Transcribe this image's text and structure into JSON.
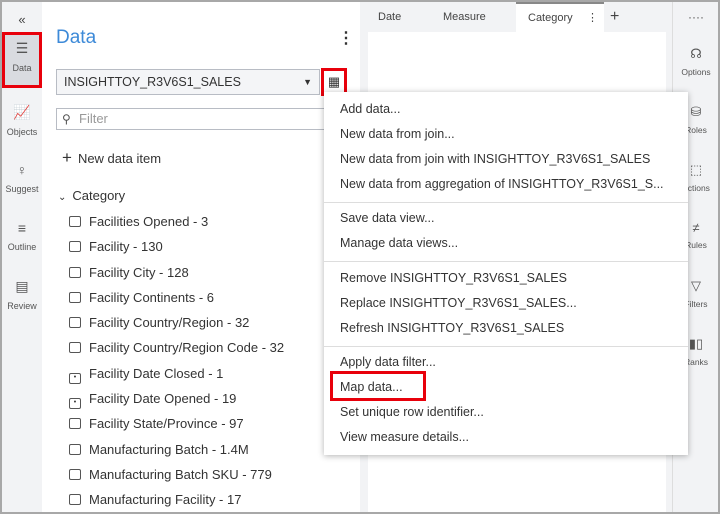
{
  "rail": {
    "items": [
      {
        "label": "Data"
      },
      {
        "label": "Objects"
      },
      {
        "label": "Suggest"
      },
      {
        "label": "Outline"
      },
      {
        "label": "Review"
      }
    ]
  },
  "panel": {
    "title": "Data",
    "source": "INSIGHTTOY_R3V6S1_SALES",
    "filter_placeholder": "Filter",
    "new_item": "New data item",
    "category": "Category",
    "items": [
      {
        "label": "Facilities Opened - 3",
        "icon": "calculated-icon"
      },
      {
        "label": "Facility - 130",
        "icon": "category-icon"
      },
      {
        "label": "Facility City - 128",
        "icon": "category-icon"
      },
      {
        "label": "Facility Continents - 6",
        "icon": "category-icon"
      },
      {
        "label": "Facility Country/Region - 32",
        "icon": "category-icon"
      },
      {
        "label": "Facility Country/Region Code - 32",
        "icon": "category-icon"
      },
      {
        "label": "Facility Date Closed - 1",
        "icon": "calendar-icon"
      },
      {
        "label": "Facility Date Opened - 19",
        "icon": "calendar-icon"
      },
      {
        "label": "Facility State/Province - 97",
        "icon": "category-icon"
      },
      {
        "label": "Manufacturing Batch - 1.4M",
        "icon": "category-icon"
      },
      {
        "label": "Manufacturing Batch SKU - 779",
        "icon": "category-icon"
      },
      {
        "label": "Manufacturing Facility - 17",
        "icon": "category-icon"
      }
    ]
  },
  "tabs": [
    {
      "label": "Date"
    },
    {
      "label": "Measure"
    },
    {
      "label": "Category"
    }
  ],
  "right": {
    "items": [
      {
        "label": "Options"
      },
      {
        "label": "Roles"
      },
      {
        "label": "Actions"
      },
      {
        "label": "Rules"
      },
      {
        "label": "Filters"
      },
      {
        "label": "Ranks"
      }
    ]
  },
  "menu": {
    "items": [
      "Add data...",
      "New data from join...",
      "New data from join with INSIGHTTOY_R3V6S1_SALES",
      "New data from aggregation of INSIGHTTOY_R3V6S1_S...",
      "Save data view...",
      "Manage data views...",
      "Remove INSIGHTTOY_R3V6S1_SALES",
      "Replace INSIGHTTOY_R3V6S1_SALES...",
      "Refresh INSIGHTTOY_R3V6S1_SALES",
      "Apply data filter...",
      "Map data...",
      "Set unique row identifier...",
      "View measure details..."
    ]
  }
}
